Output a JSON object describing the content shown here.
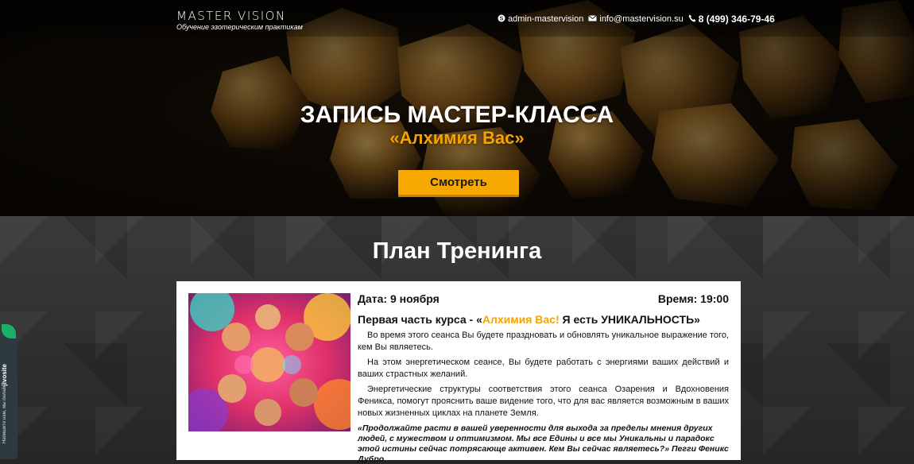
{
  "header": {
    "logo_title": "MASTER VISION",
    "logo_subtitle": "Обучение эзотерическим практикам",
    "skype": "admin-mastervision",
    "email": "info@mastervision.su",
    "phone": "8 (499) 346-79-46"
  },
  "hero": {
    "title": "ЗАПИСЬ МАСТЕР-КЛАССА",
    "subtitle": "«Алхимия Вас»",
    "watch_button": "Смотреть"
  },
  "plan": {
    "title": "План Тренинга",
    "date": "Дата: 9 ноября",
    "time": "Время: 19:00",
    "course_prefix": "Первая часть курса - «",
    "course_accent": "Алхимия Вас!",
    "course_suffix": " Я есть УНИКАЛЬНОСТЬ»",
    "paragraphs": [
      "Во время этого сеанса Вы будете праздновать и обновлять уникальное выражение того, кем Вы являетесь.",
      "На этом энергетическом сеансе, Вы будете работать с энергиями ваших действий и ваших страстных желаний.",
      "Энергетические структуры соответствия этого сеанса Озарения и Вдохновения Феникса, помогут прояснить ваше видение того, что для вас является возможным в ваших новых жизненных циклах на планете Земля."
    ],
    "quote": "«Продолжайте расти в вашей уверенности для выхода за пределы мнения других людей, с мужеством и оптимизмом. Мы все Едины и все мы Уникальны и парадокс этой истины сейчас потрясающе активен. Кем Вы сейчас являетесь?» Пегги Феникс Дубро"
  },
  "widget": {
    "brand": "jivosite",
    "label": "Напишите нам, мы онлайн!"
  },
  "colors": {
    "accent": "#f5a300",
    "button": "#f6a800"
  }
}
